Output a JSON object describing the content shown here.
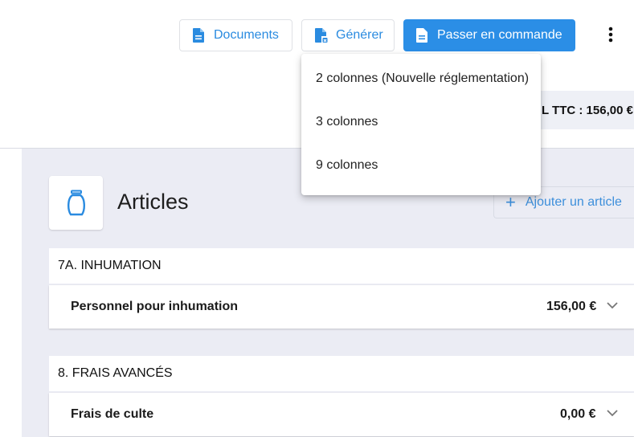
{
  "toolbar": {
    "documents_label": "Documents",
    "generate_label": "Générer",
    "order_label": "Passer en commande"
  },
  "summary": {
    "total_ttc": "L TTC : 156,00 €"
  },
  "menu": {
    "items": [
      {
        "label": "2 colonnes (Nouvelle réglementation)"
      },
      {
        "label": "3 colonnes"
      },
      {
        "label": "9 colonnes"
      }
    ]
  },
  "articles": {
    "title": "Articles",
    "add_label": "Ajouter un article",
    "sections": [
      {
        "title": "7A. INHUMATION",
        "item": "Personnel pour inhumation",
        "price": "156,00 €"
      },
      {
        "title": "8. FRAIS AVANCÉS",
        "item": "Frais de culte",
        "price": "0,00 €"
      }
    ]
  },
  "colors": {
    "accent": "#2b8ee6",
    "panel_bg": "#ebecf4",
    "link": "#2a8be0"
  },
  "icons": [
    "document-icon",
    "generate-document-icon",
    "more-vert-icon",
    "urn-icon",
    "plus-icon",
    "chevron-down-icon"
  ]
}
